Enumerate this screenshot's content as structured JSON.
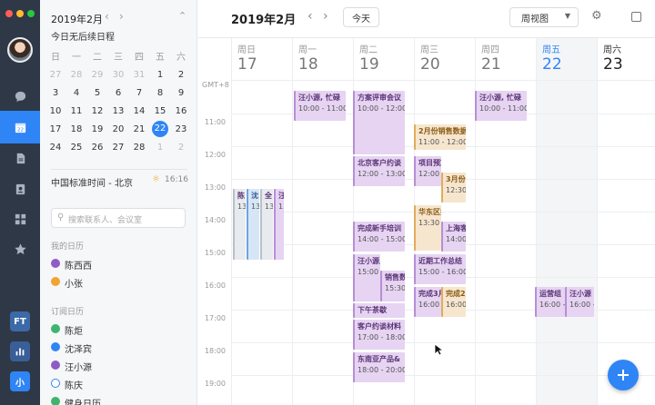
{
  "app": {
    "brand_color": "#2f85f5"
  },
  "mini_calendar": {
    "title": "2019年2月",
    "subtitle": "今日无后续日程",
    "weekdays": [
      "日",
      "一",
      "二",
      "三",
      "四",
      "五",
      "六"
    ],
    "days": [
      [
        "27",
        "28",
        "29",
        "30",
        "31",
        "1",
        "2"
      ],
      [
        "3",
        "4",
        "5",
        "6",
        "7",
        "8",
        "9"
      ],
      [
        "10",
        "11",
        "12",
        "13",
        "14",
        "15",
        "16"
      ],
      [
        "17",
        "18",
        "19",
        "20",
        "21",
        "22",
        "23"
      ],
      [
        "24",
        "25",
        "26",
        "27",
        "28",
        "1",
        "2"
      ]
    ],
    "today": "22"
  },
  "timezone": {
    "label": "中国标准时间 - 北京",
    "time": "16:16"
  },
  "search": {
    "placeholder": "搜索联系人、会议室"
  },
  "my_calendars": {
    "heading": "我的日历",
    "items": [
      {
        "name": "陈西西",
        "color": "#8e5bc7"
      },
      {
        "name": "小张",
        "color": "#f0a530"
      }
    ]
  },
  "subscribed": {
    "heading": "订阅日历",
    "items": [
      {
        "name": "陈炬",
        "color": "#3db56f",
        "checked": true
      },
      {
        "name": "沈泽宾",
        "color": "#2f85f5",
        "checked": true
      },
      {
        "name": "汪小源",
        "color": "#8e5bc7",
        "checked": true
      },
      {
        "name": "陈庆",
        "color": "#2f85f5",
        "checked": false
      },
      {
        "name": "健身日历",
        "color": "#3db56f",
        "checked": true
      }
    ]
  },
  "rail": {
    "badges": [
      "FT",
      "小"
    ]
  },
  "header": {
    "title": "2019年2月",
    "today_label": "今天",
    "view_label": "周视图",
    "timezone_label": "GMT+8"
  },
  "week": [
    {
      "name": "周日",
      "num": "17"
    },
    {
      "name": "周一",
      "num": "18"
    },
    {
      "name": "周二",
      "num": "19"
    },
    {
      "name": "周三",
      "num": "20"
    },
    {
      "name": "周四",
      "num": "21"
    },
    {
      "name": "周五",
      "num": "22",
      "today": true
    },
    {
      "name": "周六",
      "num": "23"
    }
  ],
  "hours": [
    "11:00",
    "12:00",
    "13:00",
    "14:00",
    "15:00",
    "16:00",
    "17:00",
    "18:00",
    "19:00"
  ],
  "events": [
    {
      "title": "汪小源, 忙碌",
      "time": "10:00 - 11:00",
      "color": "purple"
    },
    {
      "title": "方案评审会议",
      "time": "10:00 - 12:00",
      "color": "purple"
    },
    {
      "title": "汪小源, 忙碌",
      "time": "10:00 - 11:00",
      "color": "purple"
    },
    {
      "title": "2月份销售数据",
      "time": "11:00 - 12:00",
      "color": "orange"
    },
    {
      "title": "北京客户约谈",
      "time": "12:00 - 13:00",
      "color": "purple"
    },
    {
      "title": "项目预算",
      "time": "12:00 - 13:00",
      "color": "purple"
    },
    {
      "title": "3月份",
      "time": "12:30 - 13",
      "color": "orange"
    },
    {
      "title": "陈",
      "time": "13:",
      "color": "gray"
    },
    {
      "title": "沈",
      "time": "13:",
      "color": "blue"
    },
    {
      "title": "全",
      "time": "13:",
      "color": "gray"
    },
    {
      "title": "汪",
      "time": "13:",
      "color": "purple"
    },
    {
      "title": "华东区投放",
      "time": "13:30 - 15",
      "color": "orange"
    },
    {
      "title": "上海客",
      "time": "14:00 - 15",
      "color": "purple"
    },
    {
      "title": "完成新手培训",
      "time": "14:00 - 15:00",
      "color": "purple"
    },
    {
      "title": "汪小源, 忙碌",
      "time": "15:00 - 16:00",
      "color": "purple"
    },
    {
      "title": "销售数",
      "time": "15:30 - 16",
      "color": "purple"
    },
    {
      "title": "近期工作总结",
      "time": "15:00 - 16:00",
      "color": "purple"
    },
    {
      "title": "完成3月",
      "time": "16:00 - 16",
      "color": "purple"
    },
    {
      "title": "完成2月",
      "time": "16:00 - 16",
      "color": "orange"
    },
    {
      "title": "运营组",
      "time": "16:00 - 16",
      "color": "purple"
    },
    {
      "title": "汪小源",
      "time": "16:00 -",
      "color": "purple"
    },
    {
      "title": "下午茶歇",
      "time": "",
      "color": "purple"
    },
    {
      "title": "客户约谈材料",
      "time": "17:00 - 18:00",
      "color": "purple"
    },
    {
      "title": "东南亚产品&",
      "time": "18:00 - 20:00",
      "color": "purple"
    }
  ]
}
